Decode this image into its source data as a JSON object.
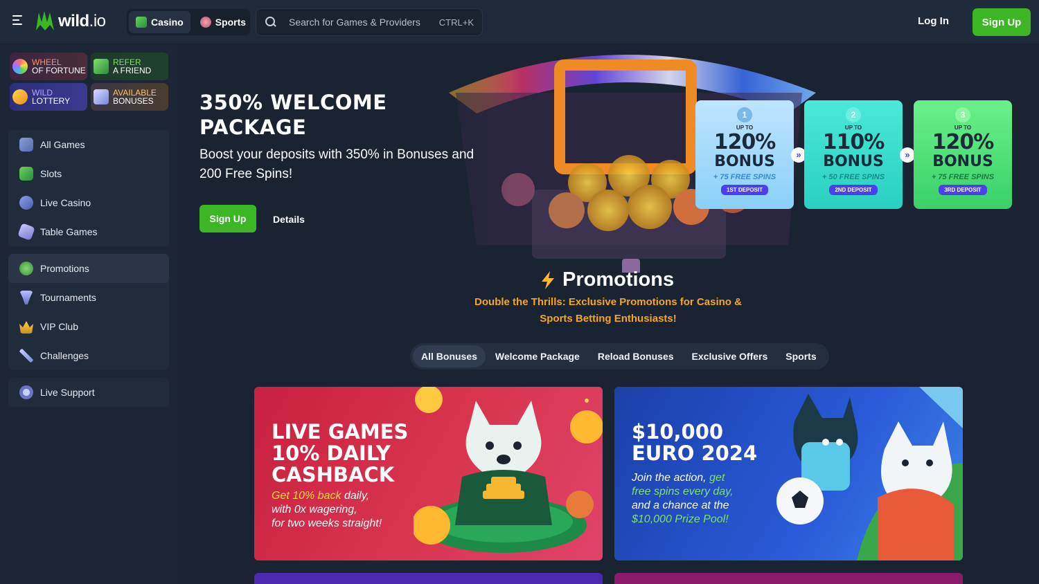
{
  "header": {
    "logo_text": "wild",
    "logo_suffix": ".io",
    "tabs": [
      {
        "label": "Casino",
        "active": true
      },
      {
        "label": "Sports",
        "active": false
      }
    ],
    "search_placeholder": "Search for Games & Providers",
    "search_shortcut": "CTRL+K",
    "login_label": "Log In",
    "signup_label": "Sign Up"
  },
  "sidebar": {
    "quick_links": [
      {
        "line1": "WHEEL",
        "line2": "OF FORTUNE"
      },
      {
        "line1": "REFER",
        "line2": "A FRIEND"
      },
      {
        "line1": "WILD",
        "line2": "LOTTERY"
      },
      {
        "line1": "AVAILABLE",
        "line2": "BONUSES"
      }
    ],
    "games": [
      "All Games",
      "Slots",
      "Live Casino",
      "Table Games"
    ],
    "extras": [
      "Promotions",
      "Tournaments",
      "VIP Club",
      "Challenges"
    ],
    "support": "Live Support"
  },
  "hero": {
    "title_line1": "350% WELCOME",
    "title_line2": "PACKAGE",
    "subtitle": "Boost your deposits with 350% in Bonuses and 200 Free Spins!",
    "signup_label": "Sign Up",
    "details_label": "Details",
    "cards": [
      {
        "num": "1",
        "upto": "UP TO",
        "pct": "120%",
        "bonus": "BONUS",
        "spins": "+ 75 FREE SPINS",
        "deposit": "1ST DEPOSIT"
      },
      {
        "num": "2",
        "upto": "UP TO",
        "pct": "110%",
        "bonus": "BONUS",
        "spins": "+ 50 FREE SPINS",
        "deposit": "2ND DEPOSIT"
      },
      {
        "num": "3",
        "upto": "UP TO",
        "pct": "120%",
        "bonus": "BONUS",
        "spins": "+ 75 FREE SPINS",
        "deposit": "3RD DEPOSIT"
      }
    ],
    "arrow_glyph": "»"
  },
  "promotions": {
    "title": "Promotions",
    "subtitle": "Double the Thrills: Exclusive Promotions for Casino & Sports Betting Enthusiasts!",
    "filters": [
      "All Bonuses",
      "Welcome Package",
      "Reload Bonuses",
      "Exclusive Offers",
      "Sports"
    ],
    "cards": [
      {
        "head1": "LIVE GAMES",
        "head2": "10% DAILY",
        "head3": "CASHBACK",
        "body_hl": "Get 10% back",
        "body_rest": " daily,",
        "body2": "with 0x wagering,",
        "body3": "for two weeks straight!"
      },
      {
        "head1": "$10,000",
        "head2": "EURO 2024",
        "body_lead": "Join the action, ",
        "body_hl": "get",
        "body2": "free spins every day,",
        "body3": "and a chance at the",
        "body4": "$10,000 Prize Pool!"
      }
    ]
  },
  "colors": {
    "accent_green": "#3cb624",
    "promo_orange": "#f5a623",
    "bg": "#1a2332"
  }
}
